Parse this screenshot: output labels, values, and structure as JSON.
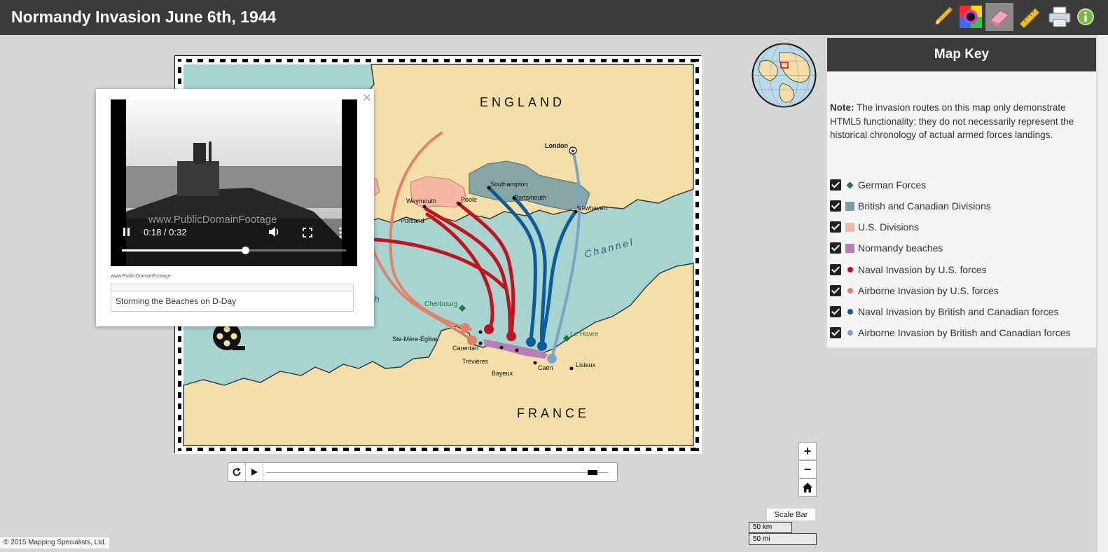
{
  "app": {
    "title": "Normandy Invasion June 6th, 1944"
  },
  "toolbar": {
    "tools": [
      {
        "icon": "pencil-icon"
      },
      {
        "icon": "color-wheel-icon"
      },
      {
        "icon": "eraser-icon"
      },
      {
        "icon": "ruler-icon"
      },
      {
        "icon": "printer-icon"
      },
      {
        "icon": "info-icon"
      }
    ]
  },
  "map": {
    "labels": {
      "england": "ENGLAND",
      "france": "FRANCE",
      "channel": "Channel",
      "channel_partial": "h",
      "london": "London",
      "southampton": "Southampton",
      "portsmouth": "Portsmouth",
      "weymouth": "Weymouth",
      "poole": "Poole",
      "portland": "Portland",
      "newhaven": "Newhaven",
      "cherbourg": "Cherbourg",
      "le_havre": "Le Havre",
      "ste_mere_eglise": "Ste-Mère-Église",
      "carentan": "Carentan",
      "trevieres": "Trévières",
      "bayeux": "Bayeux",
      "caen": "Caen",
      "lisieux": "Lisieux"
    },
    "route_colors": {
      "naval_us": "#c0121f",
      "airborne_us": "#e0826a",
      "naval_british": "#0d5c99",
      "airborne_british": "#7ea2c9"
    }
  },
  "popup": {
    "time": "0:18 / 0:32",
    "watermark": "www.PublicDomainFootage",
    "source": "www.PublicDomainFootage",
    "caption": "Storming the Beaches on D-Day",
    "progress": 0.55,
    "close_icon": "close-icon"
  },
  "map_key": {
    "title": "Map Key",
    "note_label": "Note:",
    "note_text": " The invasion routes on this map only demonstrate HTML5 functionality; they do not necessarily represent the historical chronology of actual armed forces landings.",
    "items": [
      {
        "label": "German Forces",
        "swatch": "diamond",
        "color": "#1a7a3a"
      },
      {
        "label": "British and Canadian Divisions",
        "swatch": "square",
        "color": "#7b9ea3"
      },
      {
        "label": "U.S. Divisions",
        "swatch": "square",
        "color": "#f4b8a4"
      },
      {
        "label": "Normandy beaches",
        "swatch": "square",
        "color": "#b77fb5"
      },
      {
        "label": "Naval Invasion by U.S. forces",
        "swatch": "dot",
        "color": "#c0121f"
      },
      {
        "label": "Airborne Invasion by U.S. forces",
        "swatch": "dot",
        "color": "#e0826a"
      },
      {
        "label": "Naval Invasion by British and Canadian forces",
        "swatch": "dot",
        "color": "#0d5c99"
      },
      {
        "label": "Airborne Invasion by British and Canadian forces",
        "swatch": "dot",
        "color": "#7ea2c9"
      }
    ]
  },
  "timeline": {
    "progress": 0.97
  },
  "zoom": {
    "in": "+",
    "out": "−"
  },
  "scale": {
    "button": "Scale Bar",
    "km": "50 km",
    "mi": "50 mi"
  },
  "footer": {
    "copyright": "© 2015 Mapping Specialists, Ltd."
  }
}
